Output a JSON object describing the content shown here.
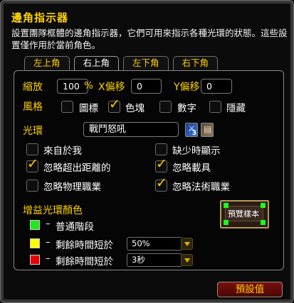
{
  "title": "邊角指示器",
  "description": "設置團隊框體的邊角指示器，它們可用來指示各種光環的狀態。這些設置僅作用於當前角色。",
  "tabs": [
    "左上角",
    "右上角",
    "左下角",
    "右下角"
  ],
  "active_tab": "右上角",
  "scale": {
    "label": "縮放",
    "value": "100",
    "unit": "%"
  },
  "x_offset": {
    "label": "X偏移",
    "value": "0"
  },
  "y_offset": {
    "label": "Y偏移",
    "value": "0"
  },
  "style": {
    "label": "風格",
    "options": [
      {
        "label": "圖標",
        "checked": false
      },
      {
        "label": "色塊",
        "checked": true
      },
      {
        "label": "數字",
        "checked": false
      },
      {
        "label": "隱藏",
        "checked": false
      }
    ]
  },
  "aura": {
    "label": "光環",
    "value": "戰鬥怒吼",
    "badge": "3"
  },
  "filters": [
    {
      "label": "來自於我",
      "checked": false
    },
    {
      "label": "缺少時顯示",
      "checked": false
    },
    {
      "label": "忽略超出距離的",
      "checked": true
    },
    {
      "label": "忽略載具",
      "checked": true
    },
    {
      "label": "忽略物理職業",
      "checked": false
    },
    {
      "label": "忽略法術職業",
      "checked": true
    }
  ],
  "gain_colors": {
    "label": "增益光環顏色",
    "rows": [
      {
        "color": "#1ee81e",
        "text": "普通階段",
        "dash": "–"
      },
      {
        "color": "#ffff00",
        "text": "剩餘時間短於",
        "dash": "–",
        "dropdown": "50%"
      },
      {
        "color": "#e80000",
        "text": "剩餘時間短於",
        "dash": "–",
        "dropdown": "3秒"
      }
    ]
  },
  "preview": {
    "label": "預覽樣本"
  },
  "default_button": "預設值"
}
